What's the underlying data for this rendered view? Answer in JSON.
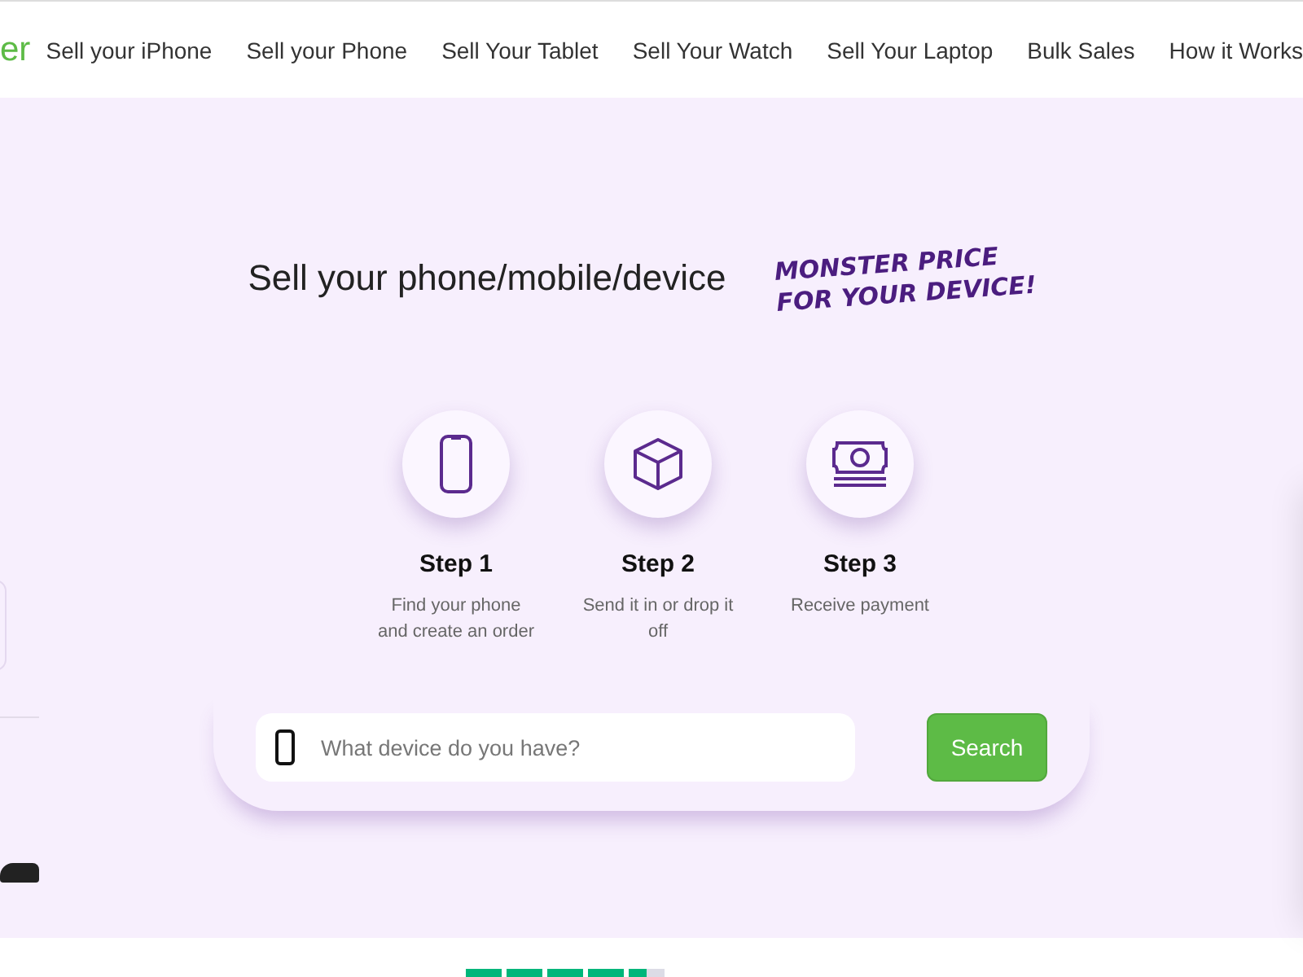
{
  "logo": {
    "text": "er"
  },
  "nav": [
    {
      "label": "Sell your iPhone"
    },
    {
      "label": "Sell your Phone"
    },
    {
      "label": "Sell Your Tablet"
    },
    {
      "label": "Sell Your Watch"
    },
    {
      "label": "Sell Your Laptop"
    },
    {
      "label": "Bulk Sales"
    },
    {
      "label": "How it Works"
    }
  ],
  "hero": {
    "title": "Sell your phone/mobile/device",
    "tagline": "MONSTER PRICE FOR YOUR DEVICE!"
  },
  "steps": [
    {
      "kind": "phone",
      "title": "Step 1",
      "text": "Find your phone and create an order"
    },
    {
      "kind": "box",
      "title": "Step 2",
      "text": "Send it in or drop it off"
    },
    {
      "kind": "cash",
      "title": "Step 3",
      "text": "Receive payment"
    }
  ],
  "search": {
    "placeholder": "What device do you have?",
    "button": "Search"
  },
  "rating": {
    "stars": 4.5
  }
}
